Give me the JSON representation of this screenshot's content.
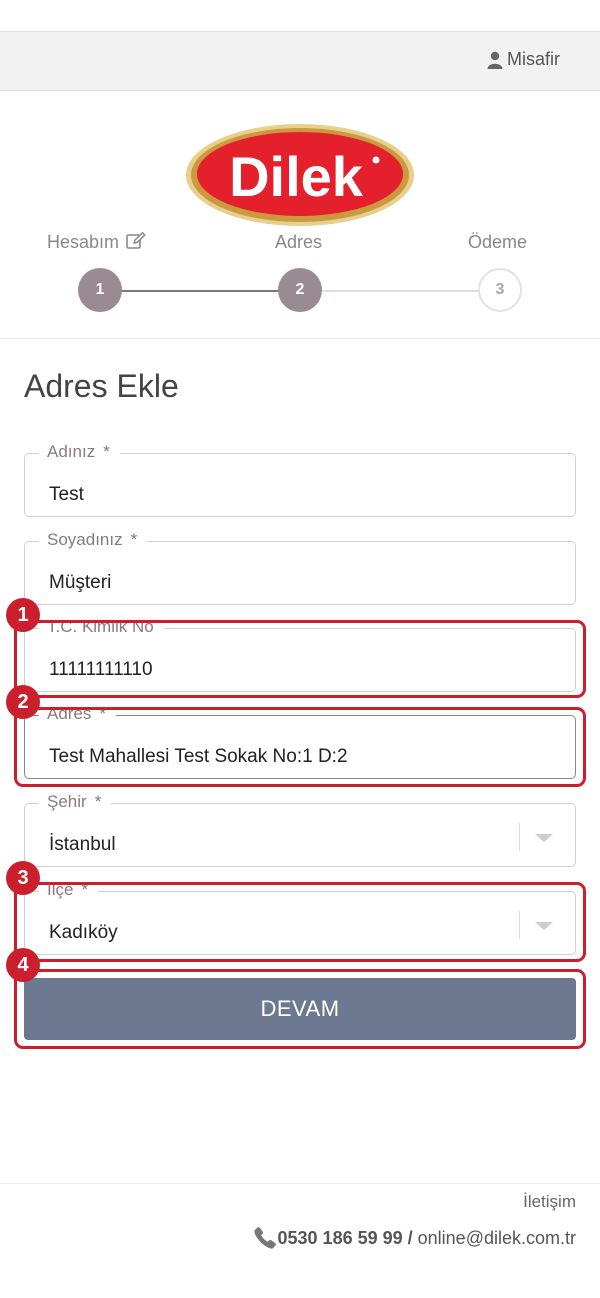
{
  "header": {
    "guest_label": "Misafir"
  },
  "logo": {
    "text": "Dilek",
    "color": "#e3202b",
    "ring_color": "#d8b35a"
  },
  "steps": [
    {
      "label": "Hesabım",
      "number": "1",
      "status": "done"
    },
    {
      "label": "Adres",
      "number": "2",
      "status": "current"
    },
    {
      "label": "Ödeme",
      "number": "3",
      "status": "todo"
    }
  ],
  "form": {
    "title": "Adres Ekle",
    "required_mark": "*",
    "fields": [
      {
        "label": "Adınız",
        "value": "Test",
        "required": true
      },
      {
        "label": "Soyadınız",
        "value": "Müşteri",
        "required": true
      },
      {
        "label": "T.C. Kimlik No",
        "value": "11111111110",
        "required": false
      },
      {
        "label": "Adres",
        "value": "Test Mahallesi Test Sokak No:1 D:2",
        "required": true
      },
      {
        "label": "Şehir",
        "value": "İstanbul",
        "required": true,
        "type": "select"
      },
      {
        "label": "Ilçe",
        "value": "Kadıköy",
        "required": true,
        "type": "select"
      }
    ],
    "submit_label": "DEVAM"
  },
  "annotations": [
    "1",
    "2",
    "3",
    "4"
  ],
  "footer": {
    "contact_title": "İletişim",
    "phone": "0530 186 59 99",
    "separator": " / ",
    "email": "online@dilek.com.tr"
  },
  "colors": {
    "accent": "#cc1f2e",
    "step_done": "#9a8a91",
    "button": "#6d7891"
  }
}
